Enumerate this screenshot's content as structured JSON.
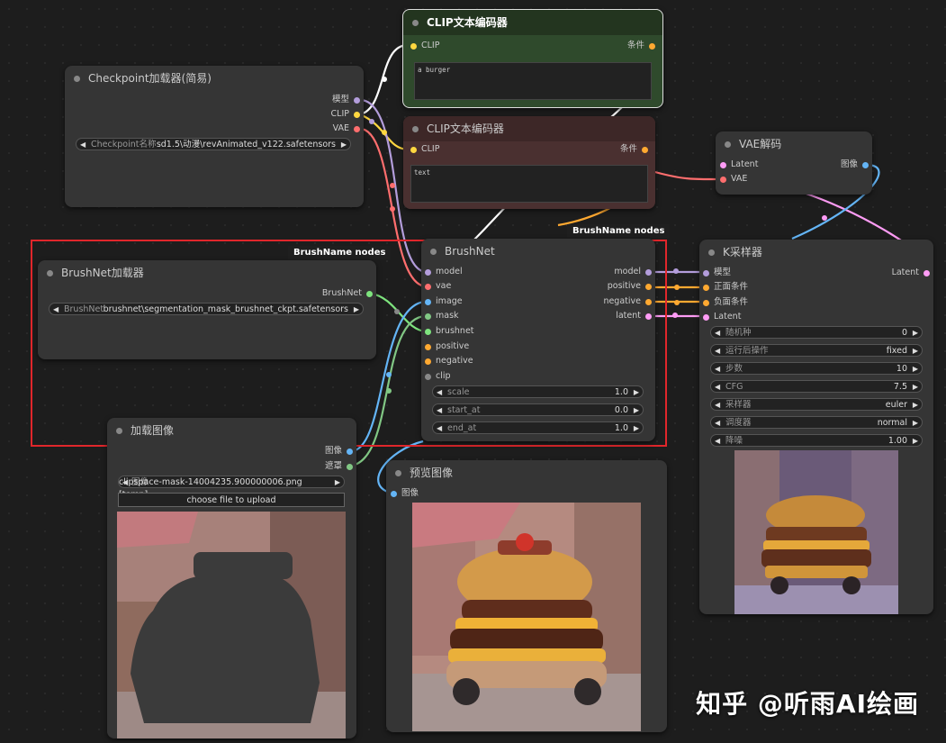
{
  "nodes": {
    "clip1": {
      "title": "CLIP文本编码器",
      "in_clip": "CLIP",
      "out": "条件",
      "text": "a burger"
    },
    "clip2": {
      "title": "CLIP文本编码器",
      "in_clip": "CLIP",
      "out": "条件",
      "text": "text"
    },
    "checkpoint": {
      "title": "Checkpoint加载器(简易)",
      "out_model": "模型",
      "out_clip": "CLIP",
      "out_vae": "VAE",
      "widget_label": "Checkpoint名称",
      "widget_value": "sd1.5\\动漫\\revAnimated_v122.safetensors"
    },
    "vae_decode": {
      "title": "VAE解码",
      "in_latent": "Latent",
      "in_vae": "VAE",
      "out": "图像"
    },
    "brushnet_loader": {
      "title": "BrushNet加载器",
      "out": "BrushNet",
      "widget_label": "BrushNet",
      "widget_value": "brushnet\\segmentation_mask_brushnet_ckpt.safetensors"
    },
    "brushnet": {
      "title": "BrushNet",
      "inputs": [
        "model",
        "vae",
        "image",
        "mask",
        "brushnet",
        "positive",
        "negative",
        "clip"
      ],
      "outputs": [
        "model",
        "positive",
        "negative",
        "latent"
      ],
      "widgets": [
        {
          "label": "scale",
          "value": "1.0"
        },
        {
          "label": "start_at",
          "value": "0.0"
        },
        {
          "label": "end_at",
          "value": "1.0"
        }
      ]
    },
    "ksampler": {
      "title": "K采样器",
      "inputs": [
        "模型",
        "正面条件",
        "负面条件",
        "Latent"
      ],
      "out": "Latent",
      "widgets": [
        {
          "label": "随机种",
          "value": "0"
        },
        {
          "label": "运行后操作",
          "value": "fixed"
        },
        {
          "label": "步数",
          "value": "10"
        },
        {
          "label": "CFG",
          "value": "7.5"
        },
        {
          "label": "采样器",
          "value": "euler"
        },
        {
          "label": "调度器",
          "value": "normal"
        },
        {
          "label": "降噪",
          "value": "1.00"
        }
      ]
    },
    "load_image": {
      "title": "加载图像",
      "out_image": "图像",
      "out_mask": "遮罩",
      "widget_label": "图像",
      "widget_value": "clipspace-mask-14004235.900000006.png [temp]",
      "upload_label": "choose file to upload"
    },
    "preview": {
      "title": "预览图像",
      "in_image": "图像"
    }
  },
  "group_labels": {
    "main": "BrushName nodes",
    "top": "BrushName nodes"
  },
  "watermark": "知乎 @听雨AI绘画",
  "colors": {
    "model": "#b39ddb",
    "clip": "#ffd740",
    "vae": "#ff6e6e",
    "image": "#64b5f6",
    "mask": "#81c784",
    "latent": "#ff9cf5",
    "cond": "#ffa931",
    "brushnet": "#7ee47e",
    "clip_gray": "#888888",
    "accent": "#e0262b"
  }
}
